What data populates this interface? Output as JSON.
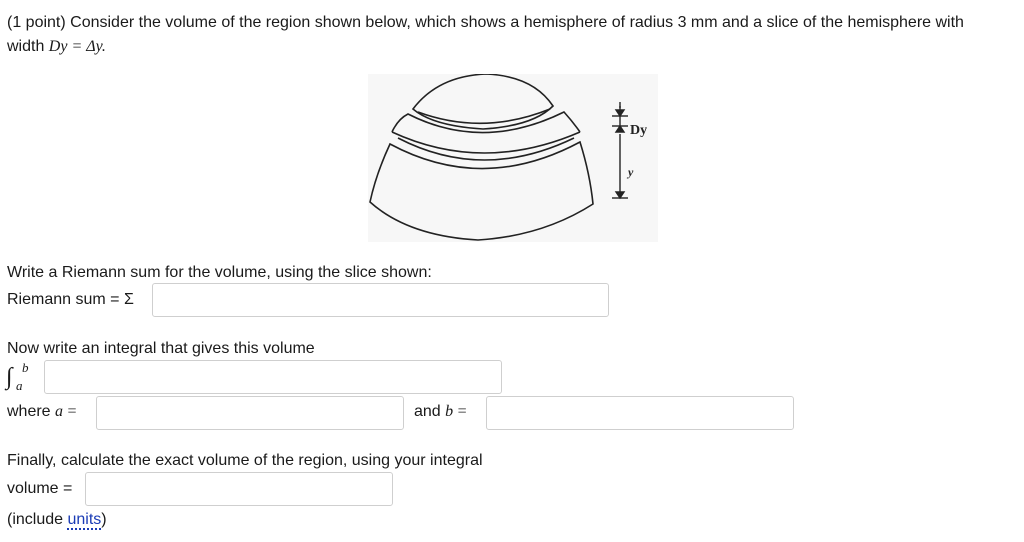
{
  "problem": {
    "intro": "(1 point) Consider the volume of the region shown below, which shows a hemisphere of radius 3 mm and a slice of the hemisphere with",
    "intro_line2_prefix": "width ",
    "intro_math": "Dy = Δy."
  },
  "figure": {
    "label_dy": "Dy",
    "label_y": "y"
  },
  "riemann": {
    "prompt": "Write a Riemann sum for the volume, using the slice shown:",
    "label": "Riemann sum = Σ",
    "value": ""
  },
  "integral": {
    "prompt": "Now write an integral that gives this volume",
    "sign": "∫",
    "upper": "b",
    "lower": "a",
    "value": ""
  },
  "limits": {
    "where_label": "where",
    "a_var": "a",
    "eq": "=",
    "and_label": "and",
    "b_var": "b",
    "a_value": "",
    "b_value": ""
  },
  "volume": {
    "prompt": "Finally, calculate the exact volume of the region, using your integral",
    "label": "volume =",
    "value": "",
    "units_prefix": "(include ",
    "units_link": "units",
    "units_suffix": ")"
  }
}
